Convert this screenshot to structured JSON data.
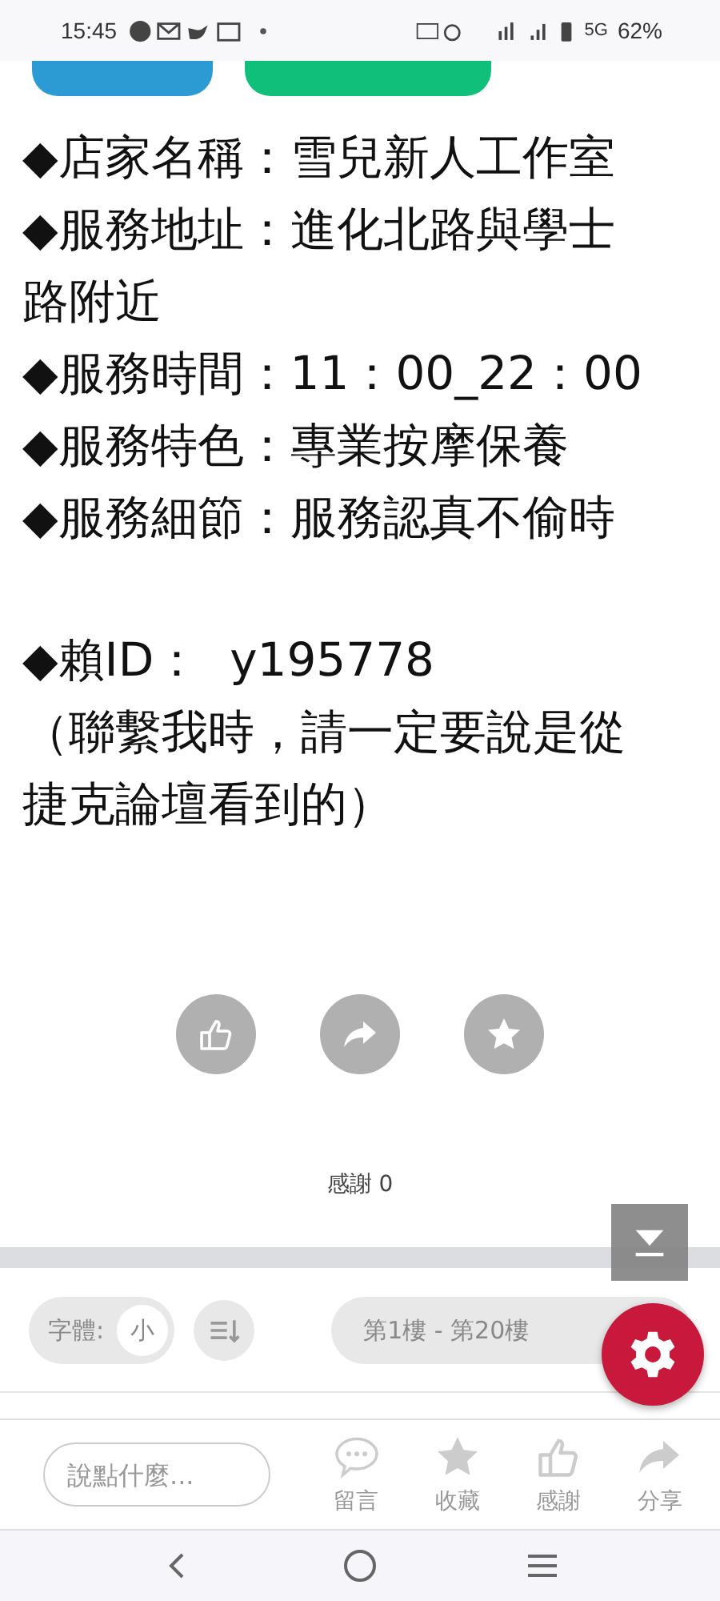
{
  "status_bar": {
    "time": "15:45",
    "battery": "62%",
    "network": "5G"
  },
  "info_blocks": [
    [
      "◆店家名稱：雪兒新人工作室",
      "◆服務地址：進化北路與學士路附近",
      "◆服務時間：11：00_22：00",
      "◆服務特色：專業按摩保養",
      "◆服務細節：服務認真不偷時"
    ],
    [
      "◆賴ID：  y195778",
      "（聯繫我時，請一定要說是從捷克論壇看到的）"
    ]
  ],
  "thanks_count": "感謝 0",
  "font_control": {
    "label": "字體:",
    "value": "小"
  },
  "floor_range": "第1樓 - 第20樓",
  "comment_field": {
    "placeholder": "說點什麼..."
  },
  "bottom_actions": [
    {
      "kind": "comment",
      "label": "留言"
    },
    {
      "kind": "star",
      "label": "收藏"
    },
    {
      "kind": "like",
      "label": "感謝"
    },
    {
      "kind": "share",
      "label": "分享"
    }
  ]
}
